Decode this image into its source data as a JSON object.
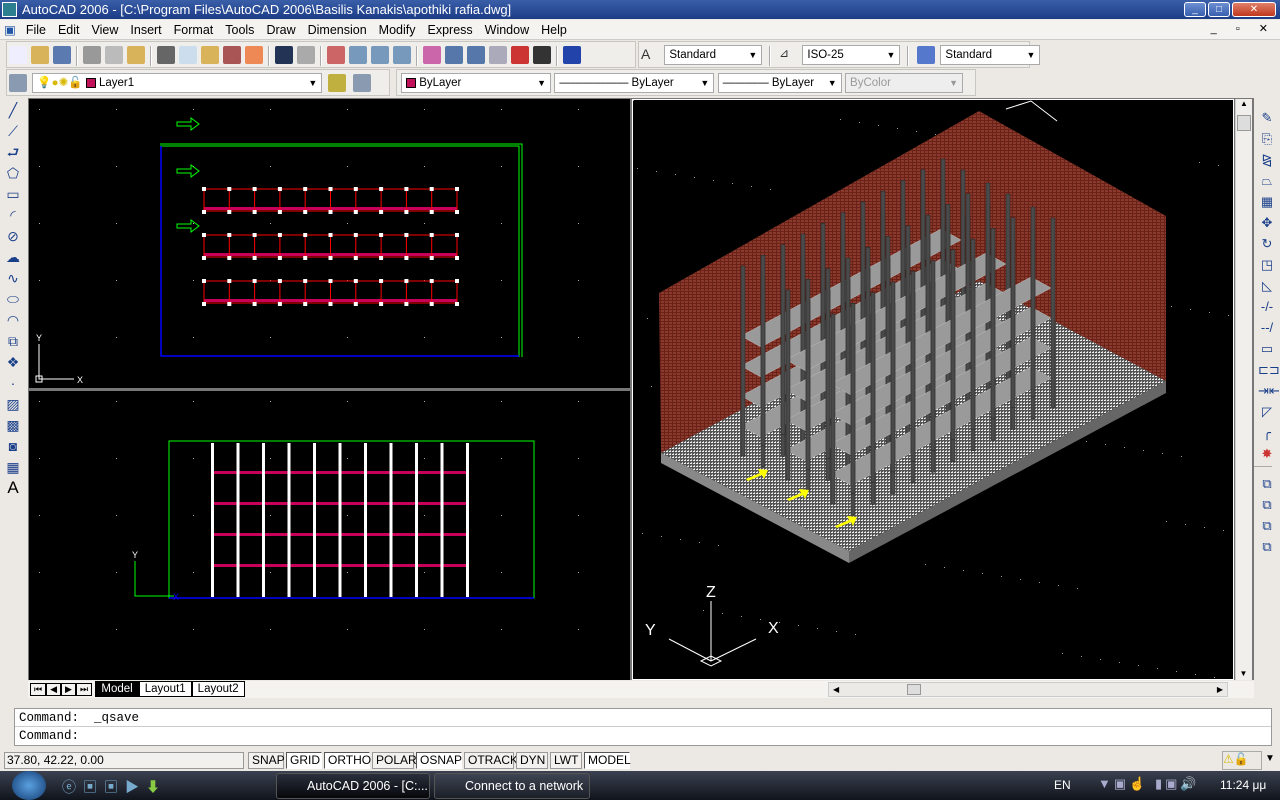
{
  "window": {
    "title": "AutoCAD 2006 - [C:\\Program Files\\AutoCAD 2006\\Basilis Kanakis\\apothiki rafia.dwg]"
  },
  "menu": [
    "File",
    "Edit",
    "View",
    "Insert",
    "Format",
    "Tools",
    "Draw",
    "Dimension",
    "Modify",
    "Express",
    "Window",
    "Help"
  ],
  "toolbar": {
    "text_style": "Standard",
    "dim_style": "ISO-25",
    "table_style": "Standard"
  },
  "layers": {
    "current_layer": "Layer1",
    "color": "ByLayer",
    "linetype": "ByLayer",
    "lineweight": "ByLayer",
    "plot_style": "ByColor",
    "layer_color": "#c0105a"
  },
  "tabs": [
    "Model",
    "Layout1",
    "Layout2"
  ],
  "active_tab": "Model",
  "command": {
    "history": "Command:  _qsave",
    "prompt": "Command:"
  },
  "status": {
    "coords": "37.80, 42.22, 0.00",
    "buttons": [
      {
        "label": "SNAP",
        "on": false
      },
      {
        "label": "GRID",
        "on": true
      },
      {
        "label": "ORTHO",
        "on": true
      },
      {
        "label": "POLAR",
        "on": false
      },
      {
        "label": "OSNAP",
        "on": true
      },
      {
        "label": "OTRACK",
        "on": false
      },
      {
        "label": "DYN",
        "on": false
      },
      {
        "label": "LWT",
        "on": false
      },
      {
        "label": "MODEL",
        "on": true
      }
    ]
  },
  "ucs": {
    "x": "X",
    "y": "Y",
    "z": "Z"
  },
  "taskbar": {
    "items": [
      "AutoCAD 2006 - [C:...",
      "Connect to a network"
    ],
    "lang": "EN",
    "clock": "11:24 μμ"
  },
  "colors": {
    "accent": "#1c3c86",
    "rack_red": "#ff0000",
    "rack_magenta": "#c8005a",
    "boundary_green": "#00ff00",
    "boundary_blue": "#0000ff",
    "wall_brick": "#7a2a20"
  }
}
